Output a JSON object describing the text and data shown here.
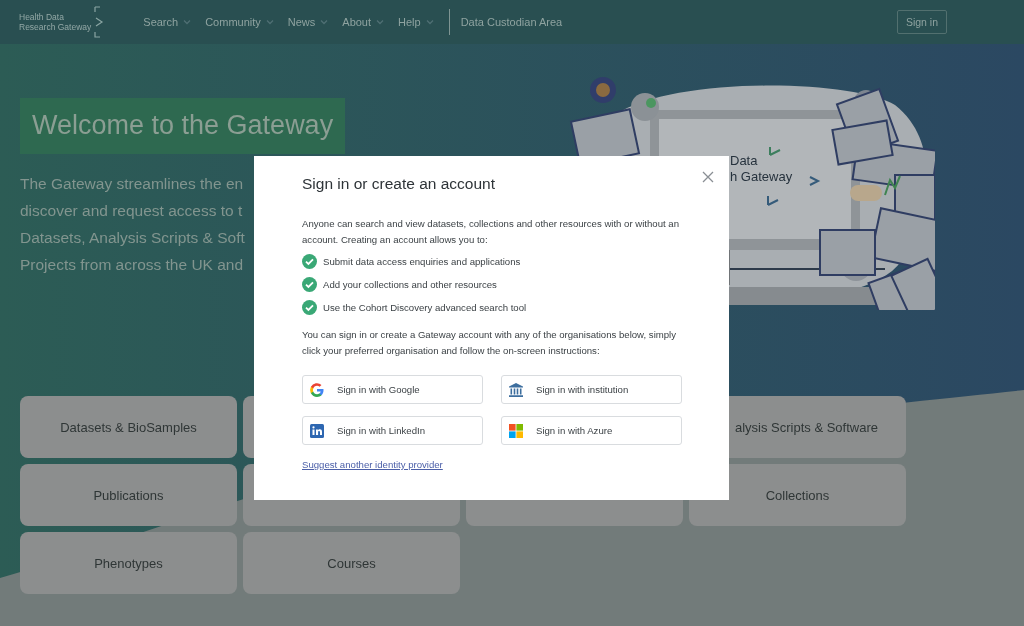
{
  "header": {
    "logo": {
      "lines": [
        "Health Data",
        "Research Gateway"
      ]
    },
    "nav": [
      {
        "label": "Search",
        "dropdown": true
      },
      {
        "label": "Community",
        "dropdown": true
      },
      {
        "label": "News",
        "dropdown": true
      },
      {
        "label": "About",
        "dropdown": true
      },
      {
        "label": "Help",
        "dropdown": true
      }
    ],
    "custodian_link": "Data Custodian Area",
    "sign_in": "Sign in"
  },
  "hero": {
    "title": "Welcome to the Gateway",
    "lines": [
      "The Gateway streamlines the en",
      "discover and request access to t",
      "Datasets, Analysis Scripts & Soft",
      "Projects from across the UK and"
    ]
  },
  "illustration": {
    "screen_text": [
      "Data",
      "h Gateway"
    ]
  },
  "tiles": [
    {
      "kind": "label",
      "label": "Datasets & BioSamples"
    },
    {
      "kind": "blank"
    },
    {
      "kind": "hidden"
    },
    {
      "kind": "label",
      "label": "alysis Scripts & Software"
    },
    {
      "kind": "label",
      "label": "Publications"
    },
    {
      "kind": "blank"
    },
    {
      "kind": "blank"
    },
    {
      "kind": "label",
      "label": "Collections"
    },
    {
      "kind": "label",
      "label": "Phenotypes"
    },
    {
      "kind": "label",
      "label": "Courses"
    }
  ],
  "modal": {
    "title": "Sign in or create an account",
    "intro": "Anyone can search and view datasets, collections and other resources with or without an account. Creating an account allows you to:",
    "benefits": [
      "Submit data access enquiries and applications",
      "Add your collections and other resources",
      "Use the Cohort Discovery advanced search tool"
    ],
    "instructions": "You can sign in or create a Gateway account with any of the organisations below, simply click your preferred organisation and follow the on-screen instructions:",
    "providers": [
      {
        "kind": "google",
        "label": "Sign in with Google"
      },
      {
        "kind": "institution",
        "label": "Sign in with institution"
      },
      {
        "kind": "linkedin",
        "label": "Sign in with LinkedIn"
      },
      {
        "kind": "azure",
        "label": "Sign in with Azure"
      }
    ],
    "link": "Suggest another identity provider"
  }
}
